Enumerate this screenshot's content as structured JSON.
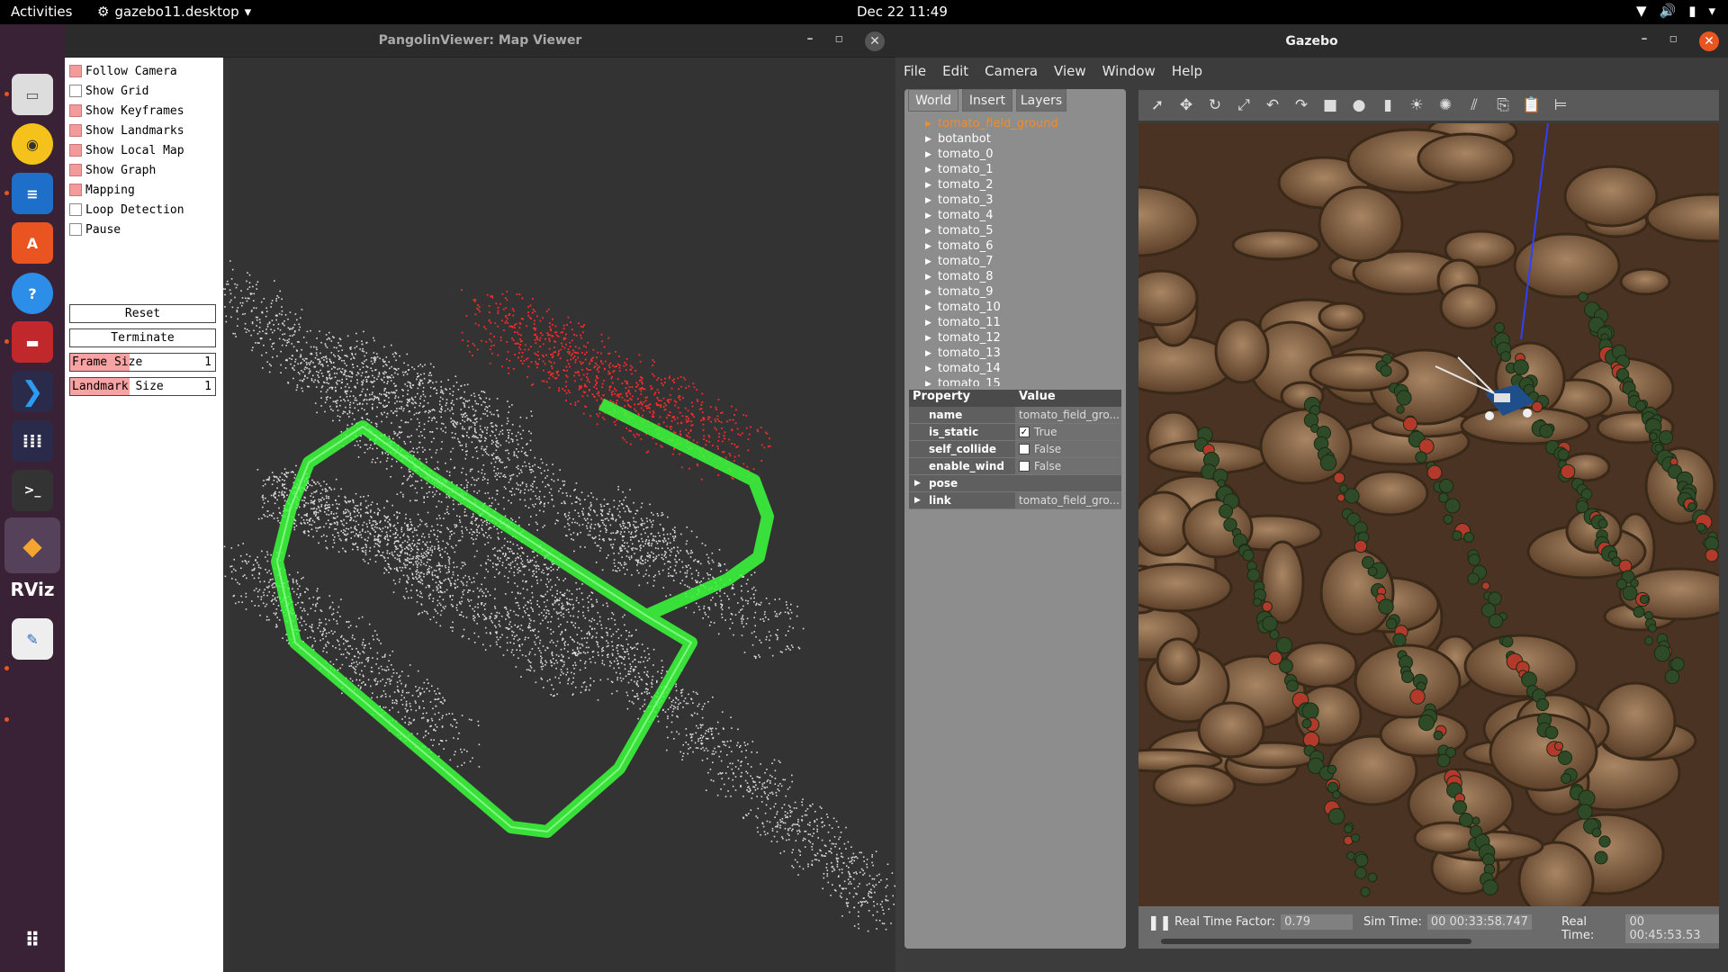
{
  "topbar": {
    "activities": "Activities",
    "app_menu": "gazebo11.desktop",
    "clock": "Dec 22  11:49"
  },
  "dock": {
    "items": [
      "Files",
      "Rhythmbox",
      "LibreOffice Writer",
      "Ubuntu Software",
      "Help",
      "Terminal Emulator",
      "Visual Studio Code",
      "App Grid",
      "Terminal",
      "Gazebo",
      "RViz",
      "Text Editor",
      "Show Applications"
    ]
  },
  "pangolin": {
    "title": "PangolinViewer: Map Viewer",
    "checkboxes": [
      {
        "label": "Follow Camera",
        "checked": true
      },
      {
        "label": "Show Grid",
        "checked": false
      },
      {
        "label": "Show Keyframes",
        "checked": true
      },
      {
        "label": "Show Landmarks",
        "checked": true
      },
      {
        "label": "Show Local Map",
        "checked": true
      },
      {
        "label": "Show Graph",
        "checked": true
      },
      {
        "label": "Mapping",
        "checked": true
      },
      {
        "label": "Loop Detection",
        "checked": false
      },
      {
        "label": "Pause",
        "checked": false
      }
    ],
    "reset_label": "Reset",
    "terminate_label": "Terminate",
    "frame_size_label": "Frame Size",
    "frame_size_value": "1",
    "landmark_size_label": "Landmark Size",
    "landmark_size_value": "1"
  },
  "gazebo": {
    "title": "Gazebo",
    "menu": [
      "File",
      "Edit",
      "Camera",
      "View",
      "Window",
      "Help"
    ],
    "tabs": [
      "World",
      "Insert",
      "Layers"
    ],
    "tree": [
      "tomato_field_ground",
      "botanbot",
      "tomato_0",
      "tomato_1",
      "tomato_2",
      "tomato_3",
      "tomato_4",
      "tomato_5",
      "tomato_6",
      "tomato_7",
      "tomato_8",
      "tomato_9",
      "tomato_10",
      "tomato_11",
      "tomato_12",
      "tomato_13",
      "tomato_14",
      "tomato_15"
    ],
    "selected_color": "#f28c28",
    "property_header": "Property",
    "value_header": "Value",
    "properties": [
      {
        "key": "name",
        "value": "tomato_field_gro..."
      },
      {
        "key": "is_static",
        "value": "True",
        "checked": true
      },
      {
        "key": "self_collide",
        "value": "False",
        "checked": false
      },
      {
        "key": "enable_wind",
        "value": "False",
        "checked": false
      }
    ],
    "pose_label": "pose",
    "link_label": "link",
    "link_value": "tomato_field_gro...",
    "status": {
      "rtf_label": "Real Time Factor:",
      "rtf_value": "0.79",
      "sim_label": "Sim Time:",
      "sim_value": "00 00:33:58.747",
      "real_label": "Real Time:",
      "real_value": "00 00:45:53.53"
    }
  }
}
